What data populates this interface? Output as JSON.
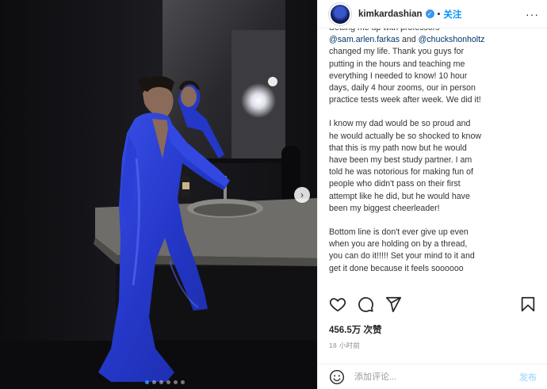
{
  "post": {
    "username": "kimkardashian",
    "separator": "•",
    "follow_label": "关注",
    "more_label": "···",
    "caption_paragraphs": [
      {
        "lines": [
          {
            "segments": [
              {
                "text": "Setting me up with professors",
                "mention": false
              }
            ]
          },
          {
            "segments": [
              {
                "text": "@sam.arlen.farkas",
                "mention": true
              },
              {
                "text": " and ",
                "mention": false
              },
              {
                "text": "@chuckshonholtz",
                "mention": true
              }
            ]
          },
          {
            "segments": [
              {
                "text": "changed my life. Thank you guys for",
                "mention": false
              }
            ]
          },
          {
            "segments": [
              {
                "text": "putting in the hours and teaching me",
                "mention": false
              }
            ]
          },
          {
            "segments": [
              {
                "text": "everything I needed to know! 10 hour",
                "mention": false
              }
            ]
          },
          {
            "segments": [
              {
                "text": "days, daily 4 hour zooms, our in person",
                "mention": false
              }
            ]
          },
          {
            "segments": [
              {
                "text": "practice tests week after week. We did it!",
                "mention": false
              }
            ]
          }
        ]
      },
      {
        "lines": [
          {
            "segments": [
              {
                "text": "I know my dad would be so proud and",
                "mention": false
              }
            ]
          },
          {
            "segments": [
              {
                "text": "he would actually be so shocked to know",
                "mention": false
              }
            ]
          },
          {
            "segments": [
              {
                "text": "that this is my path now but he would",
                "mention": false
              }
            ]
          },
          {
            "segments": [
              {
                "text": "have been my best study partner. I am",
                "mention": false
              }
            ]
          },
          {
            "segments": [
              {
                "text": "told he was notorious for making fun of",
                "mention": false
              }
            ]
          },
          {
            "segments": [
              {
                "text": "people who didn't pass on their first",
                "mention": false
              }
            ]
          },
          {
            "segments": [
              {
                "text": "attempt like he did, but he would have",
                "mention": false
              }
            ]
          },
          {
            "segments": [
              {
                "text": "been my biggest cheerleader!",
                "mention": false
              }
            ]
          }
        ]
      },
      {
        "lines": [
          {
            "segments": [
              {
                "text": "Bottom line is don't ever give up even",
                "mention": false
              }
            ]
          },
          {
            "segments": [
              {
                "text": "when you are holding on by a thread,",
                "mention": false
              }
            ]
          },
          {
            "segments": [
              {
                "text": "you can do it!!!!! Set your mind to it and",
                "mention": false
              }
            ]
          },
          {
            "segments": [
              {
                "text": "get it done because it feels soooooo",
                "mention": false
              }
            ]
          }
        ]
      }
    ],
    "likes": "456.5万 次赞",
    "time_ago": "18 小时前",
    "comment_placeholder": "添加评论...",
    "post_label": "发布",
    "carousel_next": "›",
    "carousel_count": 6,
    "carousel_active_index": 0
  },
  "icons": {
    "verified": "verified-badge-icon",
    "like": "heart-icon",
    "comment": "comment-bubble-icon",
    "share": "paper-plane-icon",
    "save": "bookmark-icon",
    "emoji": "smiley-icon"
  },
  "colors": {
    "accent": "#0095f6",
    "mention": "#00376b",
    "dress_blue": "#2a3fd6",
    "photo_bg": "#15151a"
  }
}
